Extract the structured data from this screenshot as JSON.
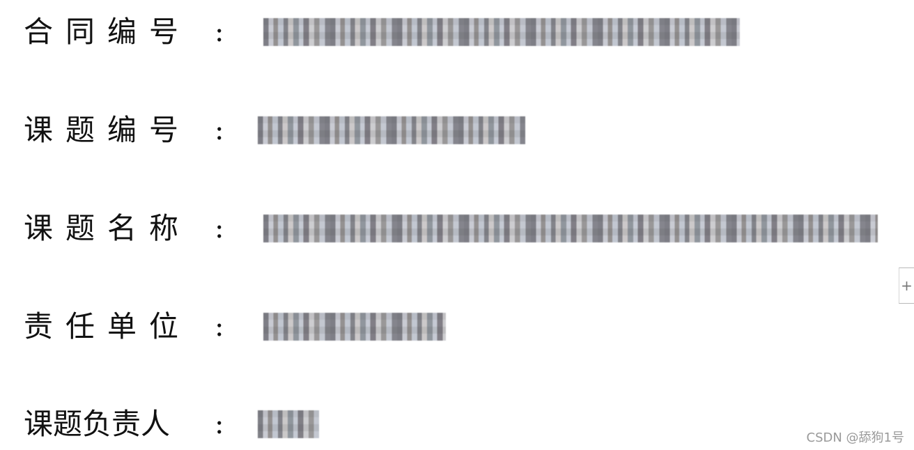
{
  "fields": [
    {
      "label": "合同编号",
      "colon": ":",
      "value_redacted": true
    },
    {
      "label": "课题编号",
      "colon": ":",
      "value_redacted": true
    },
    {
      "label": "课题名称",
      "colon": ":",
      "value_redacted": true
    },
    {
      "label": "责任单位",
      "colon": ":",
      "value_redacted": true
    },
    {
      "label": "课题负责人",
      "colon": ":",
      "value_redacted": true
    }
  ],
  "scroll_handle": {
    "icon": "plus-icon",
    "glyph": "+"
  },
  "watermark": {
    "text": "CSDN @舔狗1号"
  }
}
